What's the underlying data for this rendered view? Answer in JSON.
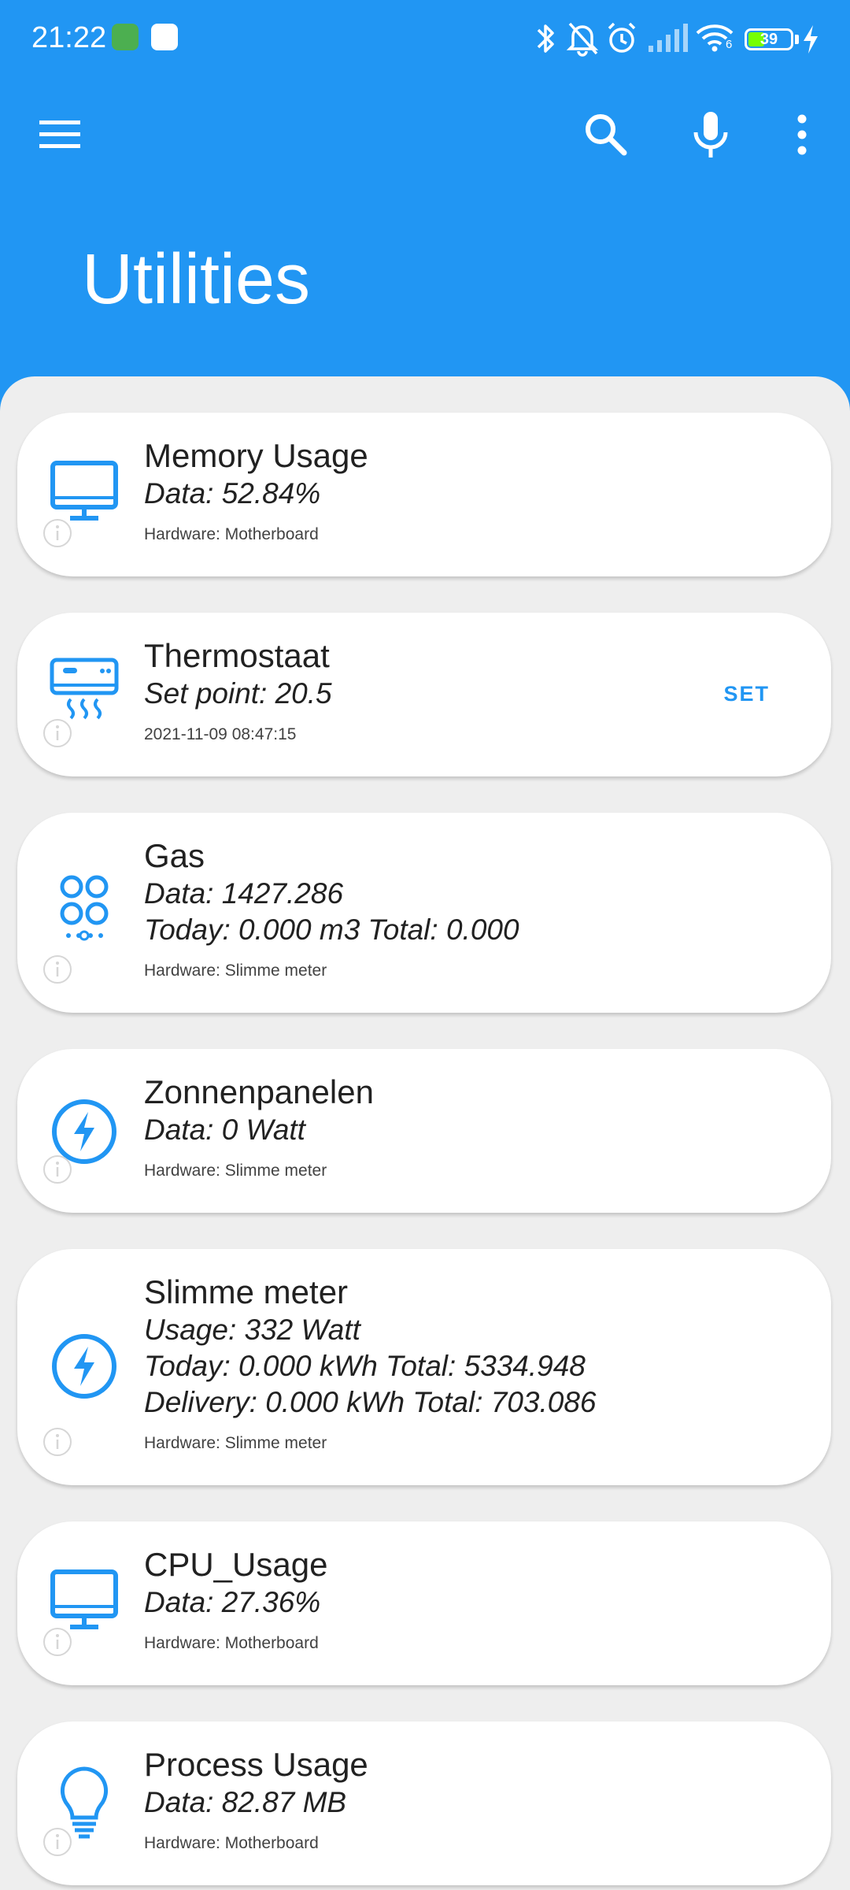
{
  "status_bar": {
    "time": "21:22",
    "battery": "39",
    "wifi_badge": "6"
  },
  "toolbar": {
    "title": "Utilities"
  },
  "cards": [
    {
      "title": "Memory Usage",
      "lines": [
        "Data: 52.84%"
      ],
      "sub": "Hardware: Motherboard",
      "icon": "monitor-icon"
    },
    {
      "title": "Thermostaat",
      "lines": [
        "Set point: 20.5"
      ],
      "sub": "2021-11-09 08:47:15",
      "icon": "air-conditioner-icon",
      "action": "SET"
    },
    {
      "title": "Gas",
      "lines": [
        "Data: 1427.286",
        "Today: 0.000 m3 Total: 0.000"
      ],
      "sub": "Hardware: Slimme meter",
      "icon": "gas-burner-icon"
    },
    {
      "title": "Zonnenpanelen",
      "lines": [
        "Data: 0 Watt"
      ],
      "sub": "Hardware: Slimme meter",
      "icon": "lightning-icon"
    },
    {
      "title": "Slimme meter",
      "lines": [
        "Usage: 332 Watt",
        "Today: 0.000 kWh Total: 5334.948",
        "Delivery: 0.000 kWh Total: 703.086"
      ],
      "sub": "Hardware: Slimme meter",
      "icon": "lightning-icon"
    },
    {
      "title": "CPU_Usage",
      "lines": [
        "Data: 27.36%"
      ],
      "sub": "Hardware: Motherboard",
      "icon": "monitor-icon"
    },
    {
      "title": "Process Usage",
      "lines": [
        "Data: 82.87 MB"
      ],
      "sub": "Hardware: Motherboard",
      "icon": "light-bulb-icon"
    }
  ],
  "colors": {
    "primary": "#2196f3",
    "background": "#eeeeee",
    "card": "#ffffff",
    "text": "#212121"
  }
}
